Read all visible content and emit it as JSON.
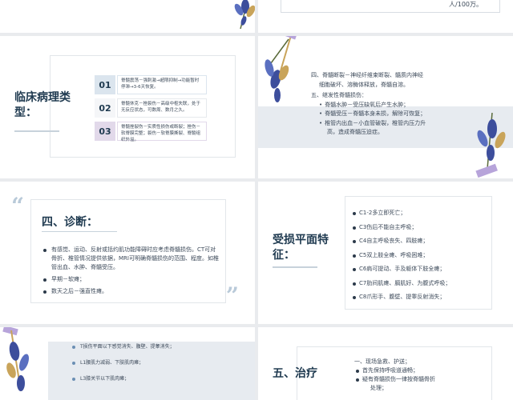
{
  "slide_top_right": {
    "tail_text": "人/100万。"
  },
  "slide_pathology": {
    "title": "临床病理类型：",
    "items": [
      {
        "num": "01",
        "text": "脊髓震荡－强刺激→超限抑制→功能暂时停滞→3-6天恢复。",
        "color": "#dbe5ee"
      },
      {
        "num": "02",
        "num_color": "#f7eef2",
        "text": "脊髓休克－挫裂伤－高级中枢失联，处于无反应状态，可数周、数月之久。",
        "color": "#eef1f4"
      },
      {
        "num": "03",
        "text": "脊髓挫裂伤－实质性损伤或断裂；挫伤－软脊膜完整；裂伤－软脊膜撕裂、脊髓组织外溢。",
        "color": "#e2d9ea"
      }
    ]
  },
  "slide_types": {
    "line1": "四、脊髓断裂－神经纤维束断裂、髓质内神经",
    "line2": "细胞破坏、溶酶体释放，脊髓自溶。",
    "line3": "五、继发性脊髓损伤：",
    "bullets": [
      "脊髓水肿－受压缺氧后产生水肿；",
      "脊髓受压－脊髓本身未损，解除可恢复；",
      "椎管内出血－小血管破裂，椎管内压力升",
      "高，造成脊髓压迫症。"
    ]
  },
  "slide_diagnosis": {
    "title": "四、诊断：",
    "quote_open": "“",
    "quote_close": "”",
    "items": [
      "有感觉、运动、反射或括约肌功能障碍时应考虑脊髓损伤。CT可对骨折、椎管情况提供依据，MRI可明确脊髓损伤的范围、程度。如椎管出血、水肿、脊髓受压。",
      "早期－软瘫；",
      "数天之后－强直性瘫。"
    ]
  },
  "slide_level": {
    "title": "受损平面特征：",
    "items": [
      "C1-2多立即死亡；",
      "C3伤后不能自主呼吸；",
      "C4自主呼吸丧失、四肢瘫；",
      "C5双上肢全瘫、呼吸困难；",
      "C6肩可提动、手及躯体下肢全瘫；",
      "C7肋间肌瘫、膈肌好、为腹式呼吸；",
      "C8爪形手、腹壁、提睾反射消失；"
    ]
  },
  "slide_lumbar": {
    "items": [
      "T损伤平面以下感觉消失、腹壁、提睾消失；",
      "L1腰肌力减弱、下肢肌肉瘫；",
      "L3膝关节以下肌肉瘫；"
    ]
  },
  "slide_treatment": {
    "title": "五、治疗",
    "line1": "一、现场急救、护送；",
    "bullet1": "首先保持呼吸道通畅；",
    "bullet2": "疑有脊髓损伤一律按脊髓骨折",
    "bullet2_cont": "处理；"
  },
  "colors": {
    "title": "#1f3a50",
    "accent": "#b9cad9",
    "band": "#e7ebf0",
    "flower_blue": "#3d4e9c",
    "flower_purple": "#b7a4da",
    "flower_gold": "#c9a45a"
  },
  "icons": [
    "flower-icon",
    "quote-icon",
    "bullet-icon"
  ]
}
